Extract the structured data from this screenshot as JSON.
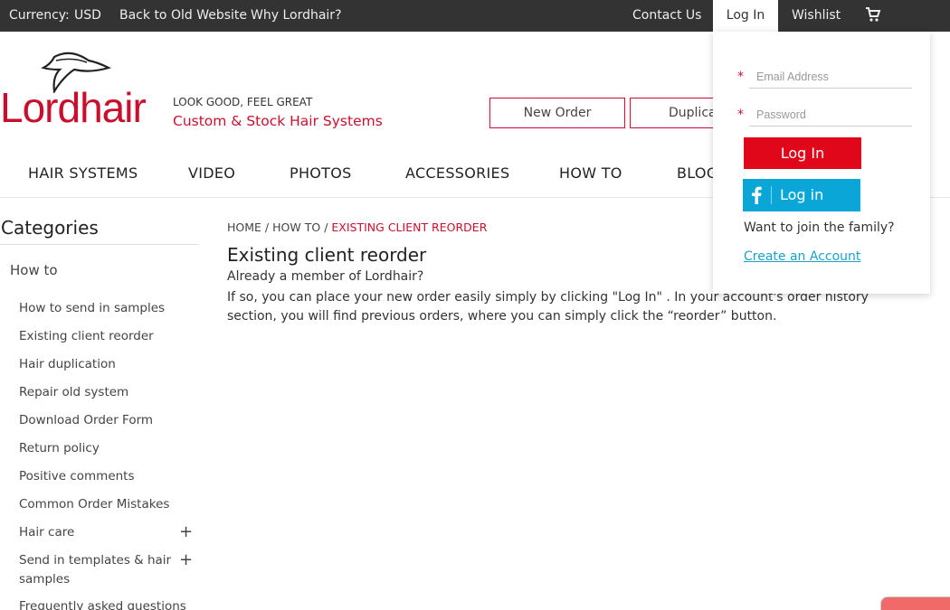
{
  "topbar": {
    "currency_label": "Currency:",
    "currency_value": "USD",
    "back_link": "Back to Old Website",
    "why_link": "Why Lordhair?",
    "contact": "Contact Us",
    "login": "Log In",
    "wishlist": "Wishlist"
  },
  "header": {
    "logo_text": "Lordhair",
    "tagline": "LOOK GOOD, FEEL GREAT",
    "subtagline": "Custom & Stock Hair Systems",
    "new_order_button": "New Order",
    "duplicate_button": "Duplica"
  },
  "nav": [
    "HAIR SYSTEMS",
    "VIDEO",
    "PHOTOS",
    "ACCESSORIES",
    "HOW TO",
    "BLOG"
  ],
  "sidebar": {
    "title": "Categories",
    "section": "How to",
    "items": [
      "How to send in samples",
      "Existing client reorder",
      "Hair duplication",
      "Repair old system",
      "Download Order Form",
      "Return policy",
      "Positive comments",
      "Common Order Mistakes",
      "Hair care",
      "Send in templates & hair samples",
      "Frequently asked questions"
    ],
    "expand_symbol": "+"
  },
  "breadcrumb": {
    "home": "HOME",
    "section": "HOW TO",
    "current": "EXISTING CLIENT REORDER",
    "separator": "/"
  },
  "content": {
    "title": "Existing client reorder",
    "line1": "Already a member of Lordhair?",
    "line2": "If so, you can place your new order easily simply by clicking \"Log In\" . In your account's order history section, you will find previous orders, where you can simply click the “reorder” button."
  },
  "login_dropdown": {
    "required_mark": "*",
    "email_placeholder": "Email Address",
    "password_placeholder": "Password",
    "login_button": "Log In",
    "facebook_button": "Log in",
    "join_text": "Want to join the family?",
    "create_link": "Create an Account"
  },
  "colors": {
    "brand_red": "#c8102e",
    "login_red": "#e0071b",
    "facebook_blue": "#0aa6d8",
    "link_blue": "#1ba1c7",
    "topbar_bg": "#333333"
  }
}
